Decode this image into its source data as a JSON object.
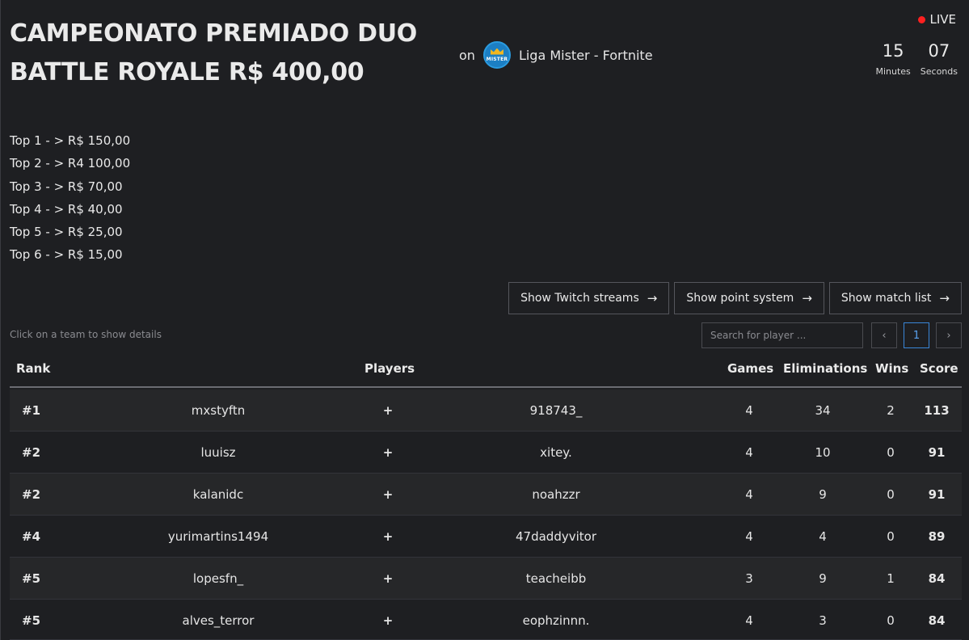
{
  "event": {
    "title_line1": "CAMPEONATO PREMIADO DUO",
    "title_line2": "BATTLE ROYALE R$ 400,00",
    "on_label": "on",
    "organizer": "Liga Mister - Fortnite",
    "logo_text": "MISTER",
    "live_label": "LIVE",
    "timer": {
      "minutes": "15",
      "minutes_label": "Minutes",
      "seconds": "07",
      "seconds_label": "Seconds"
    }
  },
  "prizes": [
    "Top 1 - > R$ 150,00",
    "Top 2 - > R4 100,00",
    "Top 3 - > R$ 70,00",
    "Top 4 - > R$ 40,00",
    "Top 5 - > R$ 25,00",
    "Top 6 - > R$ 15,00"
  ],
  "buttons": {
    "twitch": "Show Twitch streams",
    "points": "Show point system",
    "matches": "Show match list",
    "arrow": "→"
  },
  "table_controls": {
    "hint": "Click on a team to show details",
    "search_placeholder": "Search for player ...",
    "prev": "‹",
    "page": "1",
    "next": "›"
  },
  "columns": {
    "rank": "Rank",
    "players": "Players",
    "games": "Games",
    "eliminations": "Eliminations",
    "wins": "Wins",
    "score": "Score"
  },
  "rows": [
    {
      "rank": "#1",
      "p1": "mxstyftn",
      "plus": "+",
      "p2": "918743_",
      "games": "4",
      "elim": "34",
      "wins": "2",
      "score": "113"
    },
    {
      "rank": "#2",
      "p1": "luuisz",
      "plus": "+",
      "p2": "xitey.",
      "games": "4",
      "elim": "10",
      "wins": "0",
      "score": "91"
    },
    {
      "rank": "#2",
      "p1": "kalanidc",
      "plus": "+",
      "p2": "noahzzr",
      "games": "4",
      "elim": "9",
      "wins": "0",
      "score": "91"
    },
    {
      "rank": "#4",
      "p1": "yurimartins1494",
      "plus": "+",
      "p2": "47daddyvitor",
      "games": "4",
      "elim": "4",
      "wins": "0",
      "score": "89"
    },
    {
      "rank": "#5",
      "p1": "lopesfn_",
      "plus": "+",
      "p2": "teacheibb",
      "games": "3",
      "elim": "9",
      "wins": "1",
      "score": "84"
    },
    {
      "rank": "#5",
      "p1": "alves_terror",
      "plus": "+",
      "p2": "eophzinnn.",
      "games": "4",
      "elim": "3",
      "wins": "0",
      "score": "84"
    }
  ]
}
